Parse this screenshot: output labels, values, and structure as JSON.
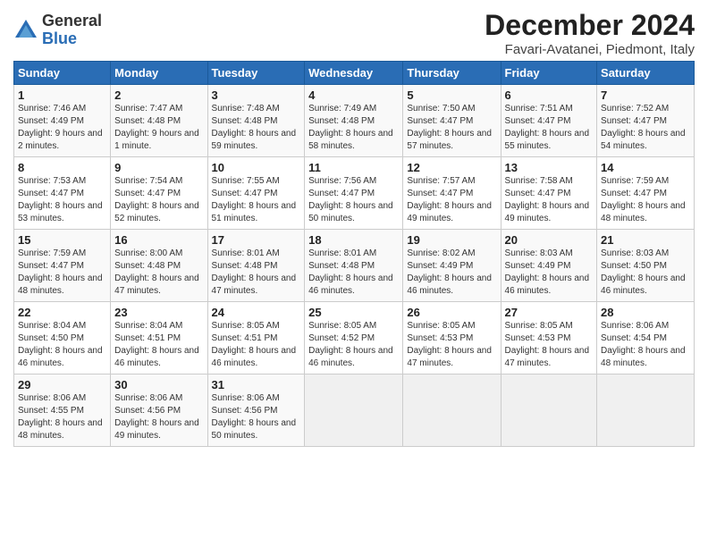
{
  "logo": {
    "general": "General",
    "blue": "Blue"
  },
  "header": {
    "title": "December 2024",
    "subtitle": "Favari-Avatanei, Piedmont, Italy"
  },
  "days_of_week": [
    "Sunday",
    "Monday",
    "Tuesday",
    "Wednesday",
    "Thursday",
    "Friday",
    "Saturday"
  ],
  "weeks": [
    [
      {
        "day": "1",
        "sunrise": "7:46 AM",
        "sunset": "4:49 PM",
        "daylight": "9 hours and 2 minutes."
      },
      {
        "day": "2",
        "sunrise": "7:47 AM",
        "sunset": "4:48 PM",
        "daylight": "9 hours and 1 minute."
      },
      {
        "day": "3",
        "sunrise": "7:48 AM",
        "sunset": "4:48 PM",
        "daylight": "8 hours and 59 minutes."
      },
      {
        "day": "4",
        "sunrise": "7:49 AM",
        "sunset": "4:48 PM",
        "daylight": "8 hours and 58 minutes."
      },
      {
        "day": "5",
        "sunrise": "7:50 AM",
        "sunset": "4:47 PM",
        "daylight": "8 hours and 57 minutes."
      },
      {
        "day": "6",
        "sunrise": "7:51 AM",
        "sunset": "4:47 PM",
        "daylight": "8 hours and 55 minutes."
      },
      {
        "day": "7",
        "sunrise": "7:52 AM",
        "sunset": "4:47 PM",
        "daylight": "8 hours and 54 minutes."
      }
    ],
    [
      {
        "day": "8",
        "sunrise": "7:53 AM",
        "sunset": "4:47 PM",
        "daylight": "8 hours and 53 minutes."
      },
      {
        "day": "9",
        "sunrise": "7:54 AM",
        "sunset": "4:47 PM",
        "daylight": "8 hours and 52 minutes."
      },
      {
        "day": "10",
        "sunrise": "7:55 AM",
        "sunset": "4:47 PM",
        "daylight": "8 hours and 51 minutes."
      },
      {
        "day": "11",
        "sunrise": "7:56 AM",
        "sunset": "4:47 PM",
        "daylight": "8 hours and 50 minutes."
      },
      {
        "day": "12",
        "sunrise": "7:57 AM",
        "sunset": "4:47 PM",
        "daylight": "8 hours and 49 minutes."
      },
      {
        "day": "13",
        "sunrise": "7:58 AM",
        "sunset": "4:47 PM",
        "daylight": "8 hours and 49 minutes."
      },
      {
        "day": "14",
        "sunrise": "7:59 AM",
        "sunset": "4:47 PM",
        "daylight": "8 hours and 48 minutes."
      }
    ],
    [
      {
        "day": "15",
        "sunrise": "7:59 AM",
        "sunset": "4:47 PM",
        "daylight": "8 hours and 48 minutes."
      },
      {
        "day": "16",
        "sunrise": "8:00 AM",
        "sunset": "4:48 PM",
        "daylight": "8 hours and 47 minutes."
      },
      {
        "day": "17",
        "sunrise": "8:01 AM",
        "sunset": "4:48 PM",
        "daylight": "8 hours and 47 minutes."
      },
      {
        "day": "18",
        "sunrise": "8:01 AM",
        "sunset": "4:48 PM",
        "daylight": "8 hours and 46 minutes."
      },
      {
        "day": "19",
        "sunrise": "8:02 AM",
        "sunset": "4:49 PM",
        "daylight": "8 hours and 46 minutes."
      },
      {
        "day": "20",
        "sunrise": "8:03 AM",
        "sunset": "4:49 PM",
        "daylight": "8 hours and 46 minutes."
      },
      {
        "day": "21",
        "sunrise": "8:03 AM",
        "sunset": "4:50 PM",
        "daylight": "8 hours and 46 minutes."
      }
    ],
    [
      {
        "day": "22",
        "sunrise": "8:04 AM",
        "sunset": "4:50 PM",
        "daylight": "8 hours and 46 minutes."
      },
      {
        "day": "23",
        "sunrise": "8:04 AM",
        "sunset": "4:51 PM",
        "daylight": "8 hours and 46 minutes."
      },
      {
        "day": "24",
        "sunrise": "8:05 AM",
        "sunset": "4:51 PM",
        "daylight": "8 hours and 46 minutes."
      },
      {
        "day": "25",
        "sunrise": "8:05 AM",
        "sunset": "4:52 PM",
        "daylight": "8 hours and 46 minutes."
      },
      {
        "day": "26",
        "sunrise": "8:05 AM",
        "sunset": "4:53 PM",
        "daylight": "8 hours and 47 minutes."
      },
      {
        "day": "27",
        "sunrise": "8:05 AM",
        "sunset": "4:53 PM",
        "daylight": "8 hours and 47 minutes."
      },
      {
        "day": "28",
        "sunrise": "8:06 AM",
        "sunset": "4:54 PM",
        "daylight": "8 hours and 48 minutes."
      }
    ],
    [
      {
        "day": "29",
        "sunrise": "8:06 AM",
        "sunset": "4:55 PM",
        "daylight": "8 hours and 48 minutes."
      },
      {
        "day": "30",
        "sunrise": "8:06 AM",
        "sunset": "4:56 PM",
        "daylight": "8 hours and 49 minutes."
      },
      {
        "day": "31",
        "sunrise": "8:06 AM",
        "sunset": "4:56 PM",
        "daylight": "8 hours and 50 minutes."
      },
      null,
      null,
      null,
      null
    ]
  ],
  "labels": {
    "sunrise": "Sunrise:",
    "sunset": "Sunset:",
    "daylight": "Daylight:"
  }
}
